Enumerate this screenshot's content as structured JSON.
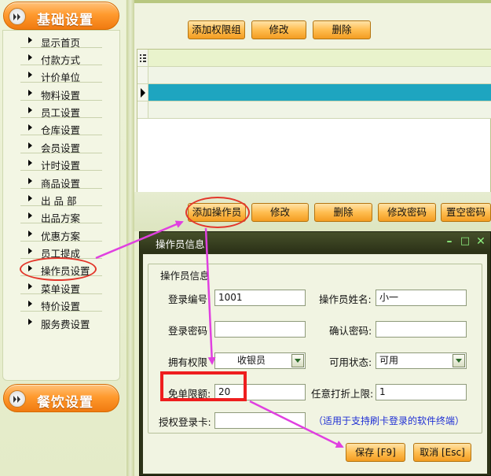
{
  "nav": {
    "section1": "基础设置",
    "section2": "餐饮设置",
    "items": [
      {
        "label": "显示首页"
      },
      {
        "label": "付款方式"
      },
      {
        "label": "计价单位"
      },
      {
        "label": "物料设置"
      },
      {
        "label": "员工设置"
      },
      {
        "label": "仓库设置"
      },
      {
        "label": "会员设置"
      },
      {
        "label": "计时设置"
      },
      {
        "label": "商品设置"
      },
      {
        "label": "出 品 部"
      },
      {
        "label": "出品方案"
      },
      {
        "label": "优惠方案"
      },
      {
        "label": "员工提成"
      },
      {
        "label": "操作员设置"
      },
      {
        "label": "菜单设置"
      },
      {
        "label": "特价设置"
      },
      {
        "label": "服务费设置"
      }
    ],
    "selected": "操作员设置"
  },
  "top_toolbar": {
    "add_group": "添加权限组",
    "edit": "修改",
    "delete": "删除"
  },
  "grid": {
    "header_icon": "grid-header-icon",
    "selected_row_color": "#1ea5c0"
  },
  "operator_toolbar": {
    "add_operator": "添加操作员",
    "edit": "修改",
    "delete": "删除",
    "change_password": "修改密码",
    "reset_password": "置空密码"
  },
  "dialog": {
    "title": "操作员信息",
    "group_title": "操作员信息",
    "fields": {
      "login_id_label": "登录编号",
      "login_id": "1001",
      "name_label": "操作员姓名:",
      "name": "小一",
      "password_label": "登录密码",
      "password": "",
      "confirm_label": "确认密码:",
      "confirm": "",
      "role_label": "拥有权限",
      "role": "收银员",
      "status_label": "可用状态:",
      "status": "可用",
      "free_limit_label": "免单限额:",
      "free_limit": "20",
      "discount_label": "任意打折上限:",
      "discount": "1",
      "card_label": "授权登录卡:",
      "card": ""
    },
    "hint": "（适用于支持刷卡登录的软件终端）",
    "save": "保存 [F9]",
    "cancel": "取消 [Esc]",
    "controls": {
      "minimize": "–",
      "maximize": "□",
      "close": "✕"
    }
  },
  "colors": {
    "accent": "#ff9a2e",
    "annotation": "#e3362a",
    "arrow": "#e040e0"
  }
}
